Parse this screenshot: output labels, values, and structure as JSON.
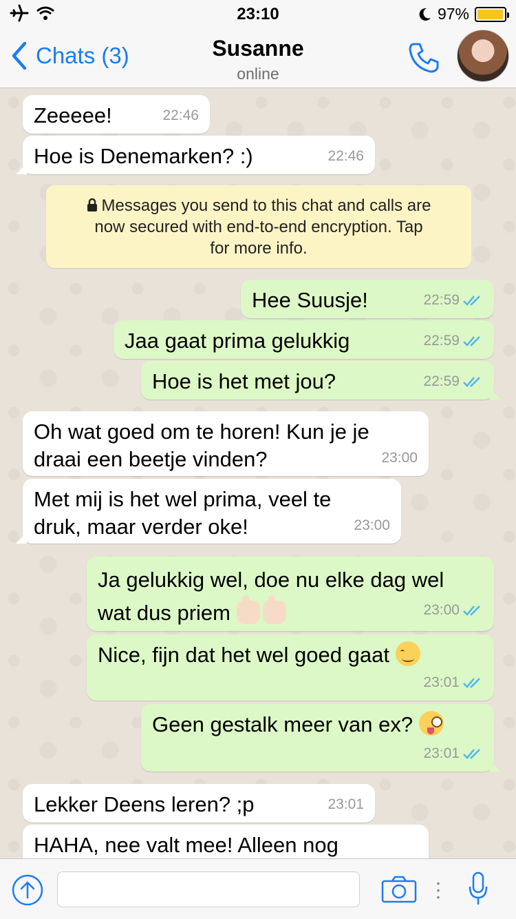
{
  "status_bar": {
    "time": "23:10",
    "battery_percent": "97%",
    "battery_level": 0.97,
    "icons": [
      "airplane-icon",
      "wifi-icon",
      "moon-icon",
      "battery-icon"
    ]
  },
  "header": {
    "back_label": "Chats (3)",
    "contact_name": "Susanne",
    "contact_status": "online",
    "icons": [
      "chevron-left-icon",
      "phone-icon",
      "avatar"
    ]
  },
  "messages": [
    {
      "dir": "in",
      "lines": [
        "Zeeeee!"
      ],
      "time": "22:46"
    },
    {
      "dir": "in",
      "lines": [
        "Hoe is Denemarken? :)"
      ],
      "time": "22:46"
    },
    {
      "dir": "out",
      "lines": [
        "Hee Suusje!"
      ],
      "time": "22:59"
    },
    {
      "dir": "out",
      "lines": [
        "Jaa gaat prima gelukkig"
      ],
      "time": "22:59"
    },
    {
      "dir": "out",
      "lines": [
        "Hoe is het met jou?"
      ],
      "time": "22:59"
    },
    {
      "dir": "in",
      "lines": [
        "Oh wat goed om te horen! Kun je je",
        "draai een beetje vinden?"
      ],
      "time": "23:00"
    },
    {
      "dir": "in",
      "lines": [
        "Met mij is het wel prima, veel te",
        "druk, maar verder oke!"
      ],
      "time": "23:00"
    },
    {
      "dir": "out",
      "lines": [
        "Ja gelukkig wel, doe nu elke dag wel",
        "wat dus priem"
      ],
      "time": "23:00",
      "emoji": "thumbs-up-icon"
    },
    {
      "dir": "out",
      "lines": [
        "Nice, fijn dat het wel goed gaat"
      ],
      "time": "23:01",
      "emoji": "smiling-face-icon"
    },
    {
      "dir": "out",
      "lines": [
        "Geen gestalk meer van ex?"
      ],
      "time": "23:01",
      "emoji": "winking-tongue-face-icon"
    },
    {
      "dir": "in",
      "lines": [
        "Lekker Deens leren? ;p"
      ],
      "time": "23:01"
    },
    {
      "dir": "in",
      "lines": [
        "HAHA, nee valt mee! Alleen nog"
      ],
      "time": ""
    }
  ],
  "encryption_notice": {
    "lines": [
      "Messages you send to this chat and calls are",
      "now secured with end-to-end encryption. Tap",
      "for more info."
    ],
    "icon": "lock-icon"
  },
  "input_bar": {
    "placeholder": "",
    "icons": [
      "upload-icon",
      "camera-icon",
      "microphone-icon"
    ]
  },
  "colors": {
    "accent": "#1a7cf5",
    "outgoing_bubble": "#dcf8c6",
    "incoming_bubble": "#ffffff",
    "notice_bg": "#fdf4c5",
    "battery": "#f9c41b",
    "read_ticks": "#4fb6ec"
  }
}
